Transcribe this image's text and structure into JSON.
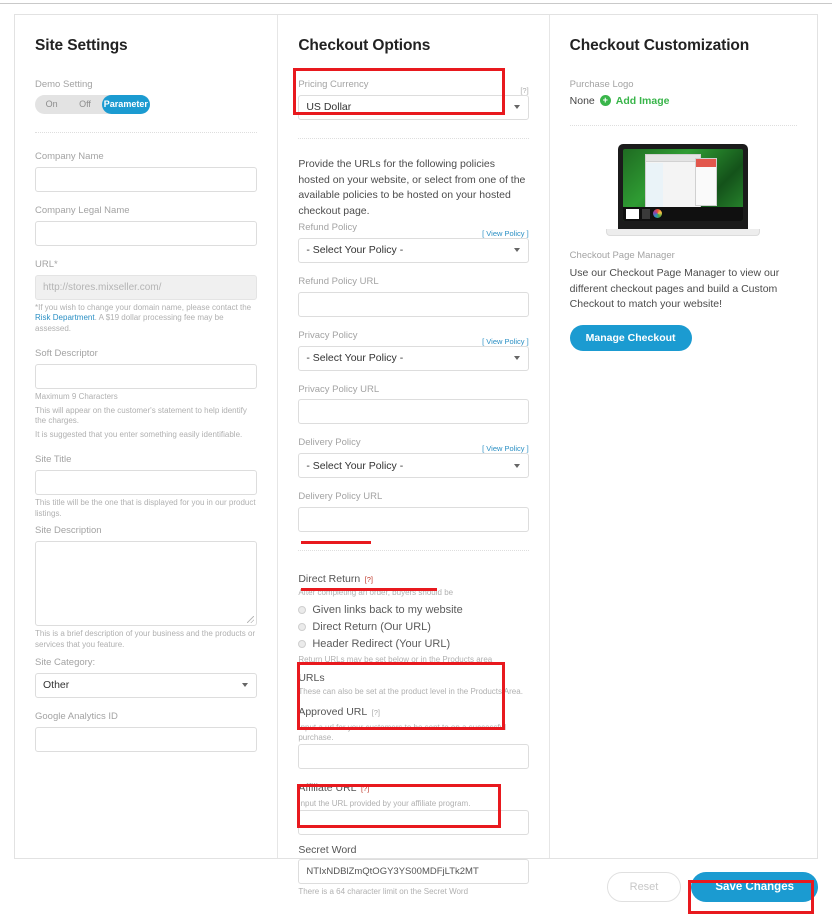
{
  "site_settings": {
    "title": "Site Settings",
    "demo_setting": {
      "label": "Demo Setting",
      "options": [
        "On",
        "Off",
        "Parameter"
      ],
      "selected": "Parameter"
    },
    "company_name": {
      "label": "Company Name",
      "value": "",
      "placeholder": ""
    },
    "company_legal_name": {
      "label": "Company Legal Name",
      "value": "",
      "placeholder": ""
    },
    "url": {
      "label": "URL*",
      "value": "http://stores.mixseller.com/",
      "hint_1": "*If you wish to change your domain name, please contact the",
      "hint_link": "Risk Department",
      "hint_2": ". A $19 dollar processing fee may be assessed."
    },
    "soft_descriptor": {
      "label": "Soft Descriptor",
      "value": "",
      "hint_1": "Maximum 9 Characters",
      "hint_2": "This will appear on the customer's statement to help identify the charges.",
      "hint_3": "It is suggested that you enter something easily identifiable."
    },
    "site_title": {
      "label": "Site Title",
      "value": "",
      "hint": "This title will be the one that is displayed for you in our product listings."
    },
    "site_description": {
      "label": "Site Description",
      "value": "",
      "hint": "This is a brief description of your business and the products or services that you feature."
    },
    "site_category": {
      "label": "Site Category:",
      "selected": "Other"
    },
    "google_analytics": {
      "label": "Google Analytics ID",
      "value": ""
    }
  },
  "checkout_options": {
    "title": "Checkout Options",
    "pricing_currency": {
      "label": "Pricing Currency",
      "help": "[?]",
      "selected": "US Dollar"
    },
    "policies_intro": "Provide the URLs for the following policies hosted on your website, or select from one of the available policies to be hosted on your hosted checkout page.",
    "view_policy_label": "[ View Policy ]",
    "policy_placeholder": "- Select Your Policy -",
    "refund_policy": {
      "label": "Refund Policy",
      "selected": "- Select Your Policy -"
    },
    "refund_policy_url": {
      "label": "Refund Policy URL",
      "value": ""
    },
    "privacy_policy": {
      "label": "Privacy Policy",
      "selected": "- Select Your Policy -"
    },
    "privacy_policy_url": {
      "label": "Privacy Policy URL",
      "value": ""
    },
    "delivery_policy": {
      "label": "Delivery Policy",
      "selected": "- Select Your Policy -"
    },
    "delivery_policy_url": {
      "label": "Delivery Policy URL",
      "value": ""
    },
    "direct_return": {
      "label": "Direct Return",
      "help": "[?]",
      "description": "After completing an order, buyers should be",
      "options": [
        "Given links back to my website",
        "Direct Return (Our URL)",
        "Header Redirect (Your URL)"
      ],
      "hint": "Return URLs may be set below or in the Products area"
    },
    "urls_section": {
      "label": "URLs",
      "hint": "These can also be set at the product level in the Products Area."
    },
    "approved_url": {
      "label": "Approved URL",
      "help": "[?]",
      "hint": "Input a url for your customers to be sent to on a successful purchase.",
      "value": ""
    },
    "affiliate_url": {
      "label": "Affiliate URL",
      "help": "[?]",
      "hint": "Input the URL provided by your affiliate program.",
      "value": ""
    },
    "secret_word": {
      "label": "Secret Word",
      "value": "NTIxNDBlZmQtOGY3YS00MDFjLTk2MT",
      "hint": "There is a 64 character limit on the Secret Word"
    }
  },
  "checkout_customization": {
    "title": "Checkout Customization",
    "purchase_logo": {
      "label": "Purchase Logo",
      "value": "None",
      "add_label": "Add Image"
    },
    "checkout_page_manager": {
      "label": "Checkout Page Manager",
      "description": "Use our Checkout Page Manager to view our different checkout pages and build a Custom Checkout to match your website!",
      "button": "Manage Checkout"
    }
  },
  "footer": {
    "reset": "Reset",
    "save": "Save Changes"
  },
  "colors": {
    "accent_blue": "#1b9bd1",
    "annotation_red": "#e8191e",
    "add_green": "#39b54a",
    "link_blue": "#2a8fc4"
  }
}
